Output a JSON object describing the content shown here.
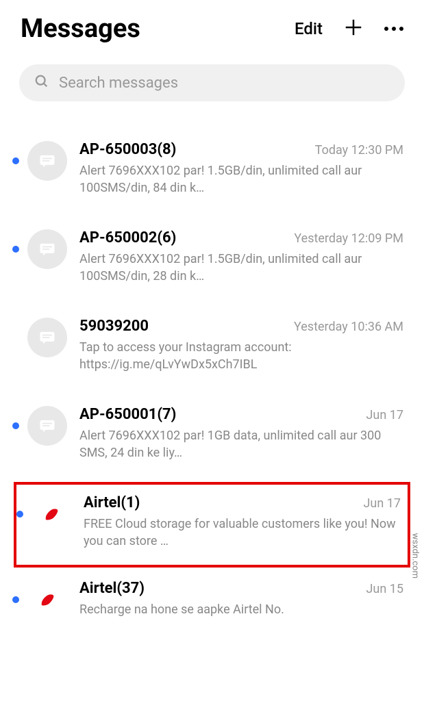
{
  "header": {
    "title": "Messages",
    "edit_label": "Edit"
  },
  "search": {
    "placeholder": "Search messages"
  },
  "conversations": [
    {
      "sender": "AP-650003(8)",
      "timestamp": "Today 12:30 PM",
      "preview": "Alert 7696XXX102 par! 1.5GB/din, unlimited call aur 100SMS/din, 84 din k…",
      "unread": true,
      "avatar_type": "generic"
    },
    {
      "sender": "AP-650002(6)",
      "timestamp": "Yesterday 12:09 PM",
      "preview": "Alert 7696XXX102 par! 1.5GB/din, unlimited call aur 100SMS/din, 28 din k…",
      "unread": true,
      "avatar_type": "generic"
    },
    {
      "sender": "59039200",
      "timestamp": "Yesterday 10:36 AM",
      "preview": "Tap to access your Instagram account: https://ig.me/qLvYwDx5xCh7IBL",
      "unread": false,
      "avatar_type": "generic"
    },
    {
      "sender": "AP-650001(7)",
      "timestamp": "Jun 17",
      "preview": "Alert 7696XXX102 par!  1GB data, unlimited call aur 300 SMS, 24 din ke liy…",
      "unread": true,
      "avatar_type": "generic"
    },
    {
      "sender": "Airtel(1)",
      "timestamp": "Jun 17",
      "preview": "FREE Cloud storage for valuable customers like you! Now you can store …",
      "unread": true,
      "avatar_type": "airtel",
      "highlighted": true
    },
    {
      "sender": "Airtel(37)",
      "timestamp": "Jun 15",
      "preview": "Recharge na hone se aapke Airtel No.",
      "unread": true,
      "avatar_type": "airtel"
    }
  ],
  "watermark": "wsxdn.com"
}
